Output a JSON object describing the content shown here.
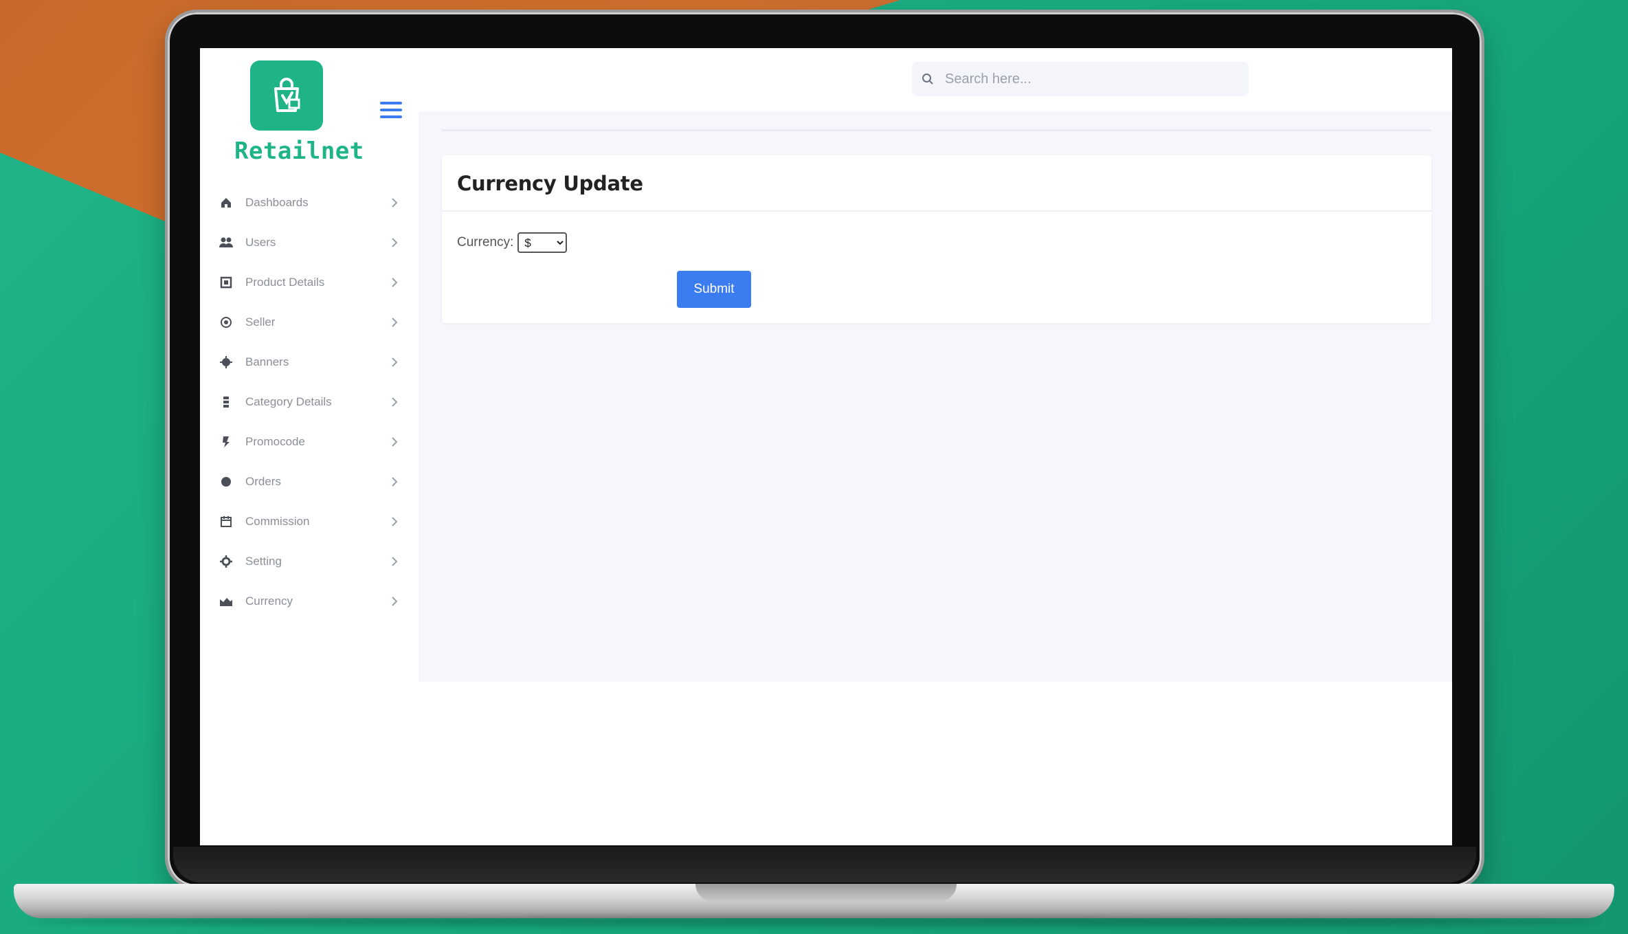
{
  "app": {
    "brand": "Retailnet"
  },
  "header": {
    "search_placeholder": "Search here...",
    "icons": [
      "search-icon",
      "moon-icon",
      "sun-icon",
      "fullscreen-icon",
      "avatar"
    ]
  },
  "sidebar": {
    "items": [
      {
        "label": "Dashboards",
        "icon": "home-icon"
      },
      {
        "label": "Users",
        "icon": "users-icon"
      },
      {
        "label": "Product Details",
        "icon": "box-icon"
      },
      {
        "label": "Seller",
        "icon": "seller-icon"
      },
      {
        "label": "Banners",
        "icon": "banner-icon"
      },
      {
        "label": "Category Details",
        "icon": "category-icon"
      },
      {
        "label": "Promocode",
        "icon": "promo-icon"
      },
      {
        "label": "Orders",
        "icon": "orders-icon"
      },
      {
        "label": "Commission",
        "icon": "commission-icon"
      },
      {
        "label": "Setting",
        "icon": "gear-icon"
      },
      {
        "label": "Currency",
        "icon": "currency-icon"
      }
    ]
  },
  "main": {
    "card_title": "Currency Update",
    "currency_label": "Currency:",
    "currency_selected": "$",
    "submit_label": "Submit"
  },
  "colors": {
    "brand_green": "#1fb487",
    "accent_blue": "#3b7cf0",
    "background_orange": "#cf6f2e"
  }
}
